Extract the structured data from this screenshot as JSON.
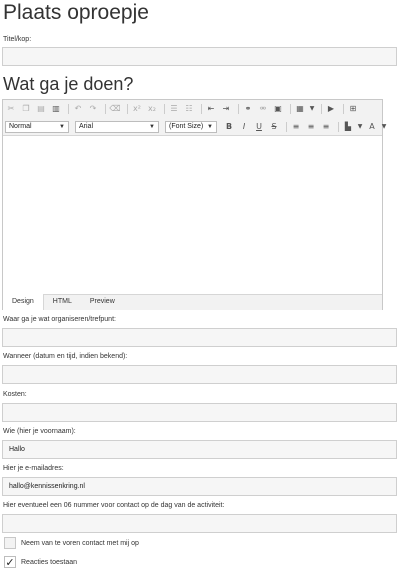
{
  "page_title": "Plaats oproepje",
  "section_title": "Wat ga je doen?",
  "fields": {
    "title": {
      "label": "Titel/kop:",
      "value": ""
    },
    "location": {
      "label": "Waar ga je wat organiseren/trefpunt:",
      "value": ""
    },
    "when": {
      "label": "Wanneer (datum en tijd, indien bekend):",
      "value": ""
    },
    "costs": {
      "label": "Kosten:",
      "value": ""
    },
    "who": {
      "label": "Wie (hier je voornaam):",
      "value": "Hallo"
    },
    "email": {
      "label": "Hier je e-mailadres:",
      "value": "hallo@kennissenkring.nl"
    },
    "phone": {
      "label": "Hier eventueel een 06 nummer voor contact op de dag van de activiteit:",
      "value": ""
    }
  },
  "editor": {
    "format_select": "Normal",
    "font_select": "Arial",
    "size_select": "(Font Size)",
    "tabs": [
      "Design",
      "HTML",
      "Preview"
    ],
    "active_tab": "Design",
    "toolbar_icons_row1": [
      "cut-icon",
      "copy-icon",
      "paste-icon",
      "paste-word-icon",
      "undo-icon",
      "redo-icon",
      "clear-format-icon",
      "superscript-icon",
      "subscript-icon",
      "ordered-list-icon",
      "unordered-list-icon",
      "outdent-icon",
      "indent-icon",
      "link-icon",
      "unlink-icon",
      "image-icon",
      "table-icon",
      "media-icon",
      "fullscreen-icon"
    ],
    "toolbar_icons_row2": [
      "bold-icon",
      "italic-icon",
      "underline-icon",
      "strikethrough-icon",
      "align-left-icon",
      "align-center-icon",
      "align-right-icon",
      "bg-color-icon",
      "font-color-icon"
    ]
  },
  "checkboxes": [
    {
      "label": "Neem van te voren contact met mij op",
      "checked": false
    },
    {
      "label": "Reacties toestaan",
      "checked": true
    }
  ]
}
